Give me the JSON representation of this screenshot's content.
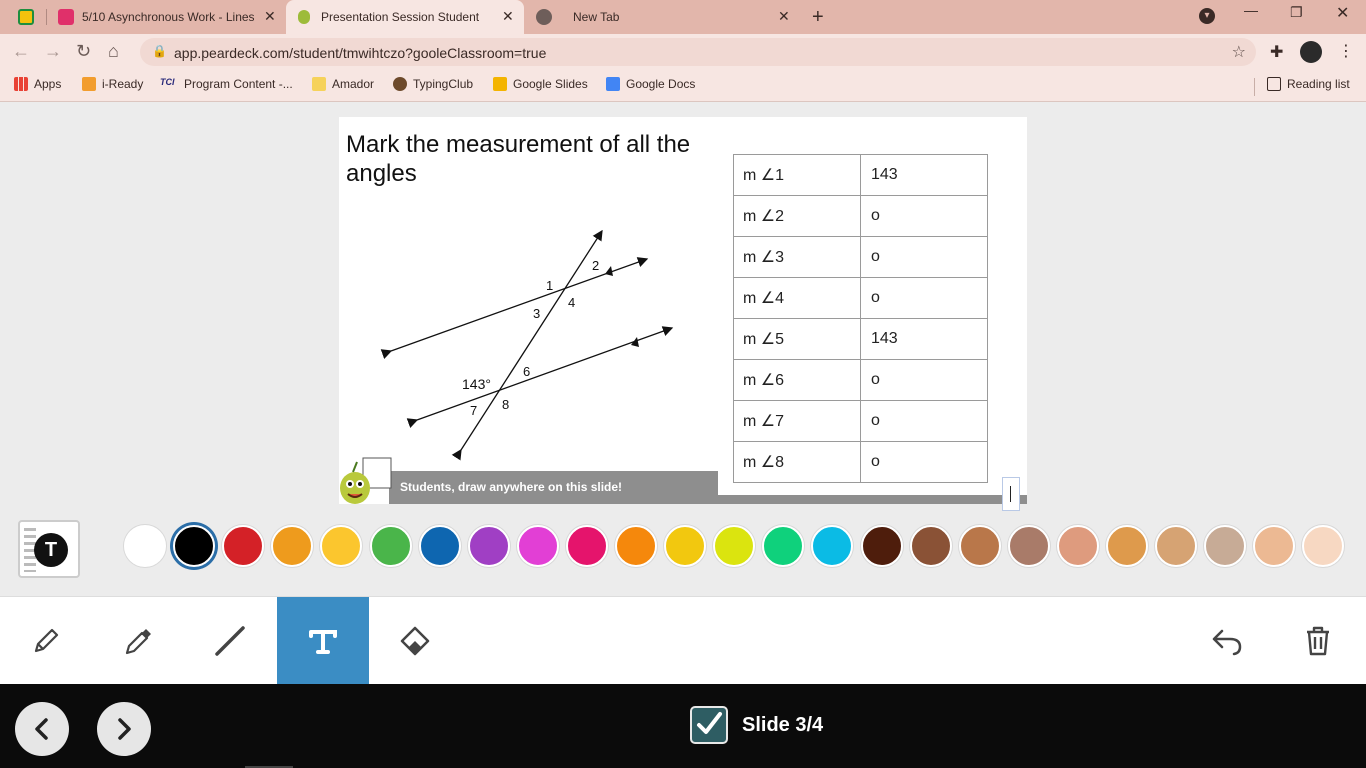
{
  "browser": {
    "tabs": [
      {
        "title": "5/10 Asynchronous Work - Lines",
        "active": false
      },
      {
        "title": "Presentation Session Student",
        "active": true
      },
      {
        "title": "New Tab",
        "active": false
      }
    ],
    "url": "app.peardeck.com/student/tmwihtczo?gooleClassroom=true",
    "bookmarks": [
      "Apps",
      "i-Ready",
      "Program Content -...",
      "Amador",
      "TypingClub",
      "Google Slides",
      "Google Docs"
    ],
    "reading_list": "Reading list"
  },
  "slide": {
    "title": "Mark the measurement of all the angles",
    "diagram_labels": {
      "given_angle": "143°",
      "a1": "1",
      "a2": "2",
      "a3": "3",
      "a4": "4",
      "a6": "6",
      "a7": "7",
      "a8": "8"
    },
    "rows": [
      {
        "label": "m ∠1",
        "value": "143"
      },
      {
        "label": "m ∠2",
        "value": "o"
      },
      {
        "label": "m ∠3",
        "value": "o"
      },
      {
        "label": "m ∠4",
        "value": "o"
      },
      {
        "label": "m ∠5",
        "value": "143"
      },
      {
        "label": "m ∠6",
        "value": "o"
      },
      {
        "label": "m ∠7",
        "value": "o"
      },
      {
        "label": "m ∠8",
        "value": "o"
      }
    ],
    "footer": "Students, draw anywhere on this slide!"
  },
  "palette": {
    "text_tool_letter": "T",
    "colors": [
      "#ffffff",
      "#000000",
      "#d42127",
      "#ee9b1d",
      "#fbc62e",
      "#4ab54a",
      "#0e66b0",
      "#a03fc4",
      "#e23fd5",
      "#e5146c",
      "#f5880c",
      "#f2c80f",
      "#dbe40f",
      "#0fd17c",
      "#0bbbe5",
      "#4e1d0c",
      "#8a5236",
      "#b9774a",
      "#a97b69",
      "#de9b7e",
      "#de9a4c",
      "#d6a373",
      "#c7ab96",
      "#ecb993",
      "#f7d8c2"
    ],
    "selected": "#000000"
  },
  "toolbar": {
    "tools": [
      "pencil",
      "marker",
      "line",
      "text",
      "eraser"
    ],
    "active": "text"
  },
  "nav": {
    "slide_label": "Slide 3/4"
  }
}
